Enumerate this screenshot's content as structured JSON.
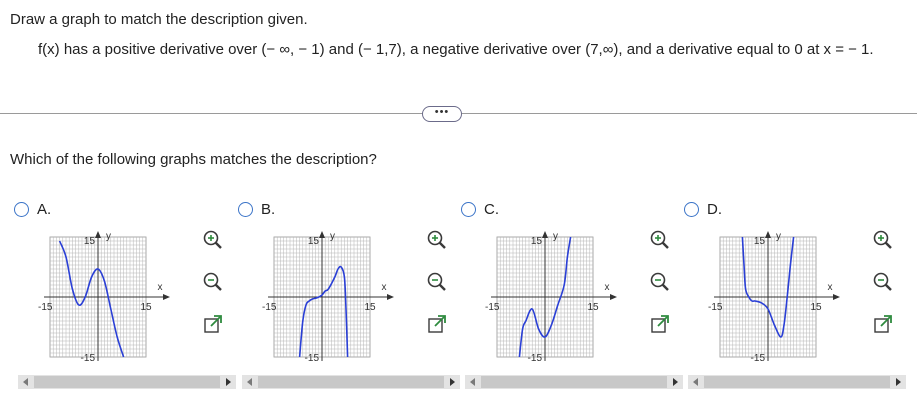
{
  "instruction": "Draw a graph to match the description given.",
  "description": "f(x) has a positive derivative over (− ∞, − 1) and (− 1,7), a negative derivative over (7,∞), and a derivative equal to 0 at x = − 1.",
  "more_button": "•••",
  "question": "Which of the following graphs matches the description?",
  "colors": {
    "curve": "#2a3fd6",
    "radio": "#3b74c8"
  },
  "axis_labels": {
    "x": "x",
    "y": "y"
  },
  "tick_labels": {
    "neg": "-15",
    "pos": "15",
    "top": "15",
    "bottom": "-15"
  },
  "options": [
    {
      "label": "A.",
      "icons": [
        "zoom-in-icon",
        "zoom-out-icon",
        "pop-out-icon"
      ]
    },
    {
      "label": "B.",
      "icons": [
        "zoom-in-icon",
        "zoom-out-icon",
        "pop-out-icon"
      ]
    },
    {
      "label": "C.",
      "icons": [
        "zoom-in-icon",
        "zoom-out-icon",
        "pop-out-icon"
      ]
    },
    {
      "label": "D.",
      "icons": [
        "zoom-in-icon",
        "zoom-out-icon",
        "pop-out-icon"
      ]
    }
  ],
  "chart_data": [
    {
      "type": "line",
      "name": "A",
      "xlim": [
        -15,
        15
      ],
      "ylim": [
        -15,
        15
      ],
      "grid": true,
      "x": [
        -12,
        -10,
        -8,
        -6,
        -4,
        -2,
        0,
        2,
        4,
        6,
        8
      ],
      "y": [
        14,
        10,
        2,
        -2,
        0,
        5,
        7,
        4,
        -3,
        -10,
        -15
      ]
    },
    {
      "type": "line",
      "name": "B",
      "xlim": [
        -15,
        15
      ],
      "ylim": [
        -15,
        15
      ],
      "grid": true,
      "x": [
        -7,
        -6,
        -5,
        -4,
        -3,
        -2,
        -1,
        0,
        1,
        2,
        4,
        5,
        6,
        7,
        7.5,
        8
      ],
      "y": [
        -15,
        -6,
        -2,
        -1,
        -0.5,
        -0.3,
        0,
        0.5,
        1.5,
        2,
        5,
        7,
        7.5,
        5,
        -3,
        -15
      ]
    },
    {
      "type": "line",
      "name": "C",
      "xlim": [
        -15,
        15
      ],
      "ylim": [
        -15,
        15
      ],
      "grid": true,
      "x": [
        -8,
        -7,
        -6,
        -4,
        -2,
        0,
        2,
        4,
        6,
        7,
        8
      ],
      "y": [
        -15,
        -8,
        -6,
        -3,
        -8,
        -10,
        -7,
        -2,
        3,
        10,
        15
      ]
    },
    {
      "type": "line",
      "name": "D",
      "xlim": [
        -15,
        15
      ],
      "ylim": [
        -15,
        15
      ],
      "grid": true,
      "x": [
        -8,
        -7.5,
        -7,
        -6,
        -5,
        -4,
        -2,
        0,
        2,
        4,
        5,
        6,
        7,
        8
      ],
      "y": [
        15,
        8,
        2,
        0,
        -1,
        -1,
        -1.5,
        -3,
        -7,
        -10,
        -7,
        0,
        8,
        15
      ]
    }
  ]
}
